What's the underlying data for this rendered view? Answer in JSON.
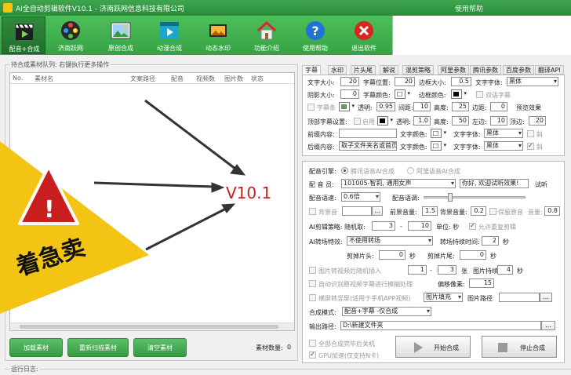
{
  "window": {
    "title": "AI全自动剪辑软件V10.1 - 济南跃网信息科技有限公司",
    "help_link": "使用帮助"
  },
  "toolbar": {
    "items": [
      {
        "label": "配音+合成",
        "icon": "clapper-icon",
        "active": true
      },
      {
        "label": "济南跃网",
        "icon": "film-reel-icon",
        "active": false
      },
      {
        "label": "原创合成",
        "icon": "picture-icon",
        "active": false
      },
      {
        "label": "动漫合成",
        "icon": "play-clapper-icon",
        "active": false
      },
      {
        "label": "动态水印",
        "icon": "slideshow-icon",
        "active": false
      },
      {
        "label": "功能介绍",
        "icon": "home-icon",
        "active": false
      },
      {
        "label": "使用帮助",
        "icon": "help-icon",
        "active": false
      },
      {
        "label": "退出软件",
        "icon": "exit-icon",
        "active": false
      }
    ]
  },
  "queue": {
    "group_label": "待合成素材队列: 右键执行更多操作",
    "columns": [
      "No.",
      "素材名",
      "文案路径",
      "配音",
      "视频数",
      "图片数",
      "状态"
    ],
    "buttons": {
      "add": "加载素材",
      "rescan": "重新扫描素材",
      "clear": "清空素材"
    },
    "count_label": "素材数量:",
    "count_value": "0"
  },
  "overlay": {
    "version_text": "V10.1",
    "promo_text": "着急卖",
    "warning_mark": "!"
  },
  "log": {
    "label": "运行日志:"
  },
  "tabs": [
    "字幕",
    "水印",
    "片头尾",
    "解说",
    "混剪策略",
    "阿里参数",
    "腾讯参数",
    "百度参数",
    "翻译API"
  ],
  "subtitle": {
    "font_size_label": "文字大小:",
    "font_size": "20",
    "position_label": "字幕位置:",
    "position": "20",
    "border_size_label": "边框大小:",
    "border_size": "0.5",
    "font_family_label": "文字字体:",
    "font_family": "黑体",
    "shadow_size_label": "阴影大小:",
    "shadow_size": "0",
    "color_label": "字幕颜色:",
    "border_color_label": "边框颜色:",
    "bilingual_label": "双语字幕",
    "bar_label": "字幕条",
    "opacity_label": "透明:",
    "opacity": "0.95",
    "spacing_label": "间距:",
    "spacing": "10",
    "height_label": "高度:",
    "height": "25",
    "margin_label": "边距:",
    "margin": "0",
    "preview_label": "预览效果",
    "top_setting_label": "顶部字幕设置:",
    "enable_label": "启用",
    "top_opacity_label": "透明:",
    "top_opacity": "1.0",
    "top_height_label": "高度:",
    "top_height": "50",
    "left_margin_label": "左边:",
    "left_margin": "10",
    "top_margin_label": "顶边:",
    "top_margin": "20",
    "front_title_label": "前缀内容:",
    "front_title": "",
    "front_color_label": "文字颜色:",
    "front_font_label": "文字字体:",
    "front_font": "黑体",
    "back_title_label": "后缀内容:",
    "back_title": "取子文件夹名或首页",
    "back_color_label": "文字颜色:",
    "back_font_label": "文字字体:",
    "back_font": "黑体",
    "bold_label": "斜",
    "italic_label": "斜"
  },
  "dubbing": {
    "engine_label": "配音引擎:",
    "engine_options": [
      "腾讯语音AI合成",
      "阿里语音AI合成"
    ],
    "voice_label": "配 音 员:",
    "voice": "101005-智莉, 通用女声",
    "sample_text": "你好, 欢迎试听效果!",
    "try_label": "试听",
    "speed_label": "配音语速:",
    "speed": "0.6倍",
    "tone_label": "配音语调:",
    "bgm_label": "背景音",
    "bgm_volume_label": "前景音量:",
    "bgm_volume": "1.5",
    "bg_volume_label": "背景音量:",
    "bg_volume": "0.2",
    "keep_original_label": "保留原音",
    "original_volume_label": "音量:",
    "original_volume": "0.8",
    "ai_cut_label": "AI剪辑策略: 随机取:",
    "ai_cut_from": "3",
    "ai_cut_to": "10",
    "unit_label": "单位: 秒",
    "allow_repeat_label": "允许重复剪辑",
    "transition_label": "AI转场特效:",
    "transition": "不使用转场",
    "transition_duration_label": "转场持续时间:",
    "transition_duration": "2",
    "sec": "秒",
    "cut_head_label": "剪掉片头:",
    "cut_head": "0",
    "cut_tail_label": "剪掉片尾:",
    "cut_tail": "0",
    "img_insert_label": "图片转视频后随机插入",
    "img_insert_from": "1",
    "img_insert_to": "3",
    "img_unit": "张",
    "img_duration_label": "图片持续:",
    "img_duration": "4",
    "auto_detect_label": "自动识别原视频字幕进行模糊处理",
    "offset_label": "偏移像素:",
    "offset": "15",
    "portrait_label": "横屏转竖屏(适用于手机APP视频)",
    "fill_mode": "图片填充",
    "img_path_label": "图片路径",
    "merge_mode_label": "合成模式:",
    "merge_mode": "配音+字幕 -仅合成",
    "output_label": "输出路径:",
    "output_path": "D:\\新建文件夹",
    "shutdown_label": "全部合成完毕后关机",
    "gpu_label": "GPU加速(仅支持N卡)",
    "start_label": "开始合成",
    "stop_label": "停止合成",
    "browse": "..."
  },
  "colors": {
    "green": "#36a244",
    "red": "#c81e1e",
    "yellow": "#f4c414"
  }
}
